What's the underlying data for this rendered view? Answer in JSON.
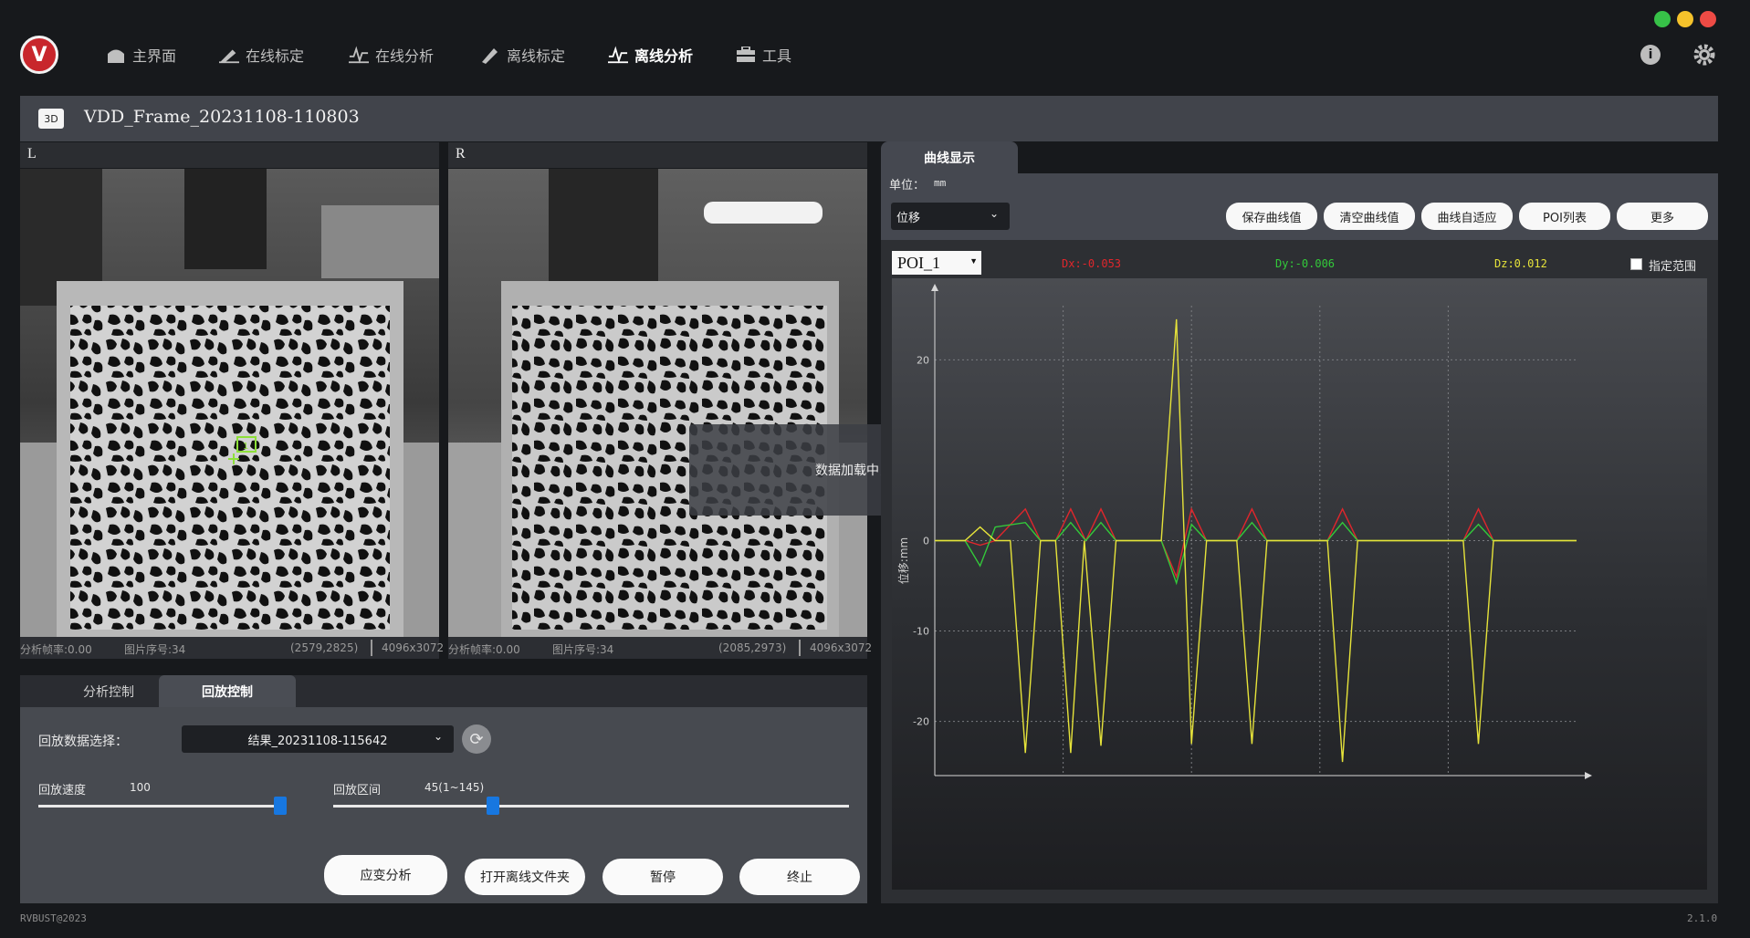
{
  "app": {
    "logo_letter": "V",
    "copyright": "RVBUST@2023",
    "version": "2.1.0"
  },
  "nav": [
    {
      "label": "主界面",
      "icon": "home-icon",
      "active": false
    },
    {
      "label": "在线标定",
      "icon": "calibrate-icon",
      "active": false
    },
    {
      "label": "在线分析",
      "icon": "wave-icon",
      "active": false
    },
    {
      "label": "离线标定",
      "icon": "pen-icon",
      "active": false
    },
    {
      "label": "离线分析",
      "icon": "wave-icon",
      "active": true
    },
    {
      "label": "工具",
      "icon": "toolbox-icon",
      "active": false
    }
  ],
  "window_controls": {
    "colors": [
      "#37c148",
      "#f5c22b",
      "#ee4b45"
    ]
  },
  "title": {
    "badge": "3D",
    "frame_name": "VDD_Frame_20231108-110803"
  },
  "left_camera": {
    "label": "L",
    "fps": "分析帧率:0.00",
    "index": "图片序号:34",
    "coord": "(2579,2825)",
    "resolution": "4096x3072",
    "poi_marker": "1"
  },
  "right_camera": {
    "label": "R",
    "fps": "分析帧率:0.00",
    "index": "图片序号:34",
    "coord": "(2085,2973)",
    "resolution": "4096x3072"
  },
  "loading_message": "数据加载中，请稍候",
  "control": {
    "tabs": [
      {
        "label": "分析控制",
        "active": false
      },
      {
        "label": "回放控制",
        "active": true
      }
    ],
    "playback_select_label": "回放数据选择：",
    "playback_select_value": "结果_20231108-115642",
    "speed_label": "回放速度",
    "speed_value": "100",
    "speed_fraction": 0.98,
    "range_label": "回放区间",
    "range_value": "45(1~145)",
    "range_fraction": 0.31,
    "buttons": [
      "应变分析",
      "打开离线文件夹",
      "暂停",
      "终止"
    ]
  },
  "curve_panel": {
    "tab": "曲线显示",
    "unit_label": "单位：",
    "unit_value": "mm",
    "type_select": "位移",
    "buttons": [
      "保存曲线值",
      "清空曲线值",
      "曲线自适应",
      "POI列表",
      "更多"
    ],
    "poi_select": "POI_1",
    "readouts": [
      {
        "text": "Dx:-0.053",
        "color": "#e0262c"
      },
      {
        "text": "Dy:-0.006",
        "color": "#33c93a"
      },
      {
        "text": "Dz:0.012",
        "color": "#e6e33a"
      }
    ],
    "range_checkbox_label": "指定范围"
  },
  "chart_data": {
    "type": "line",
    "ylabel": "位移:mm",
    "yticks": [
      "20",
      "0",
      "-10",
      "-20"
    ],
    "ylim": [
      -26,
      26
    ],
    "xlim": [
      0,
      85
    ],
    "grid": true,
    "series": [
      {
        "color": "#e0262c",
        "x": [
          0,
          4,
          6,
          8,
          12,
          14,
          16,
          18,
          20,
          22,
          24,
          26,
          28,
          30,
          32,
          34,
          36,
          38,
          40,
          42,
          44,
          46,
          48,
          50,
          52,
          54,
          56,
          58,
          60,
          62,
          64,
          66,
          68,
          70,
          72,
          74,
          76,
          78,
          80,
          82,
          85
        ],
        "y": [
          0,
          0,
          -0.5,
          0,
          3.5,
          0,
          0,
          3.5,
          0,
          3.5,
          0,
          0,
          0,
          0,
          -4,
          3.5,
          0,
          0,
          0,
          3.5,
          0,
          0,
          0,
          0,
          0,
          3.5,
          0,
          0,
          0,
          0,
          0,
          0,
          0,
          0,
          3.5,
          0,
          0,
          0,
          0,
          0,
          0
        ]
      },
      {
        "color": "#33c93a",
        "x": [
          0,
          4,
          6,
          8,
          12,
          14,
          16,
          18,
          20,
          22,
          24,
          26,
          28,
          30,
          32,
          34,
          36,
          38,
          40,
          42,
          44,
          46,
          48,
          50,
          52,
          54,
          56,
          58,
          60,
          62,
          64,
          66,
          68,
          70,
          72,
          74,
          76,
          78,
          80,
          82,
          85
        ],
        "y": [
          0,
          0,
          -2.8,
          1.5,
          2,
          0,
          0,
          2,
          0,
          2,
          0,
          0,
          0,
          0,
          -4.7,
          1.8,
          0,
          0,
          0,
          2,
          0,
          0,
          0,
          0,
          0,
          2,
          0,
          0,
          0,
          0,
          0,
          0,
          0,
          0,
          1.8,
          0,
          0,
          0,
          0,
          0,
          0
        ]
      },
      {
        "color": "#e6e33a",
        "x": [
          0,
          4,
          6,
          8,
          10,
          12,
          14,
          16,
          18,
          19.8,
          22,
          24,
          28,
          30,
          32,
          34,
          36,
          38,
          40,
          42,
          44,
          46,
          48,
          50,
          52,
          54,
          56,
          60,
          64,
          66,
          68,
          70,
          72,
          74,
          76,
          78,
          80,
          82,
          85
        ],
        "y": [
          0,
          0,
          1.5,
          0,
          0,
          -23.5,
          0,
          0,
          -23.5,
          0,
          -22.7,
          0,
          0,
          0,
          24.5,
          -22.5,
          0,
          0,
          0,
          -22.5,
          0,
          0,
          0,
          0,
          0,
          -24.5,
          0,
          0,
          0,
          0,
          0,
          0,
          -22.5,
          0,
          0,
          0,
          0,
          0,
          0
        ]
      }
    ]
  }
}
